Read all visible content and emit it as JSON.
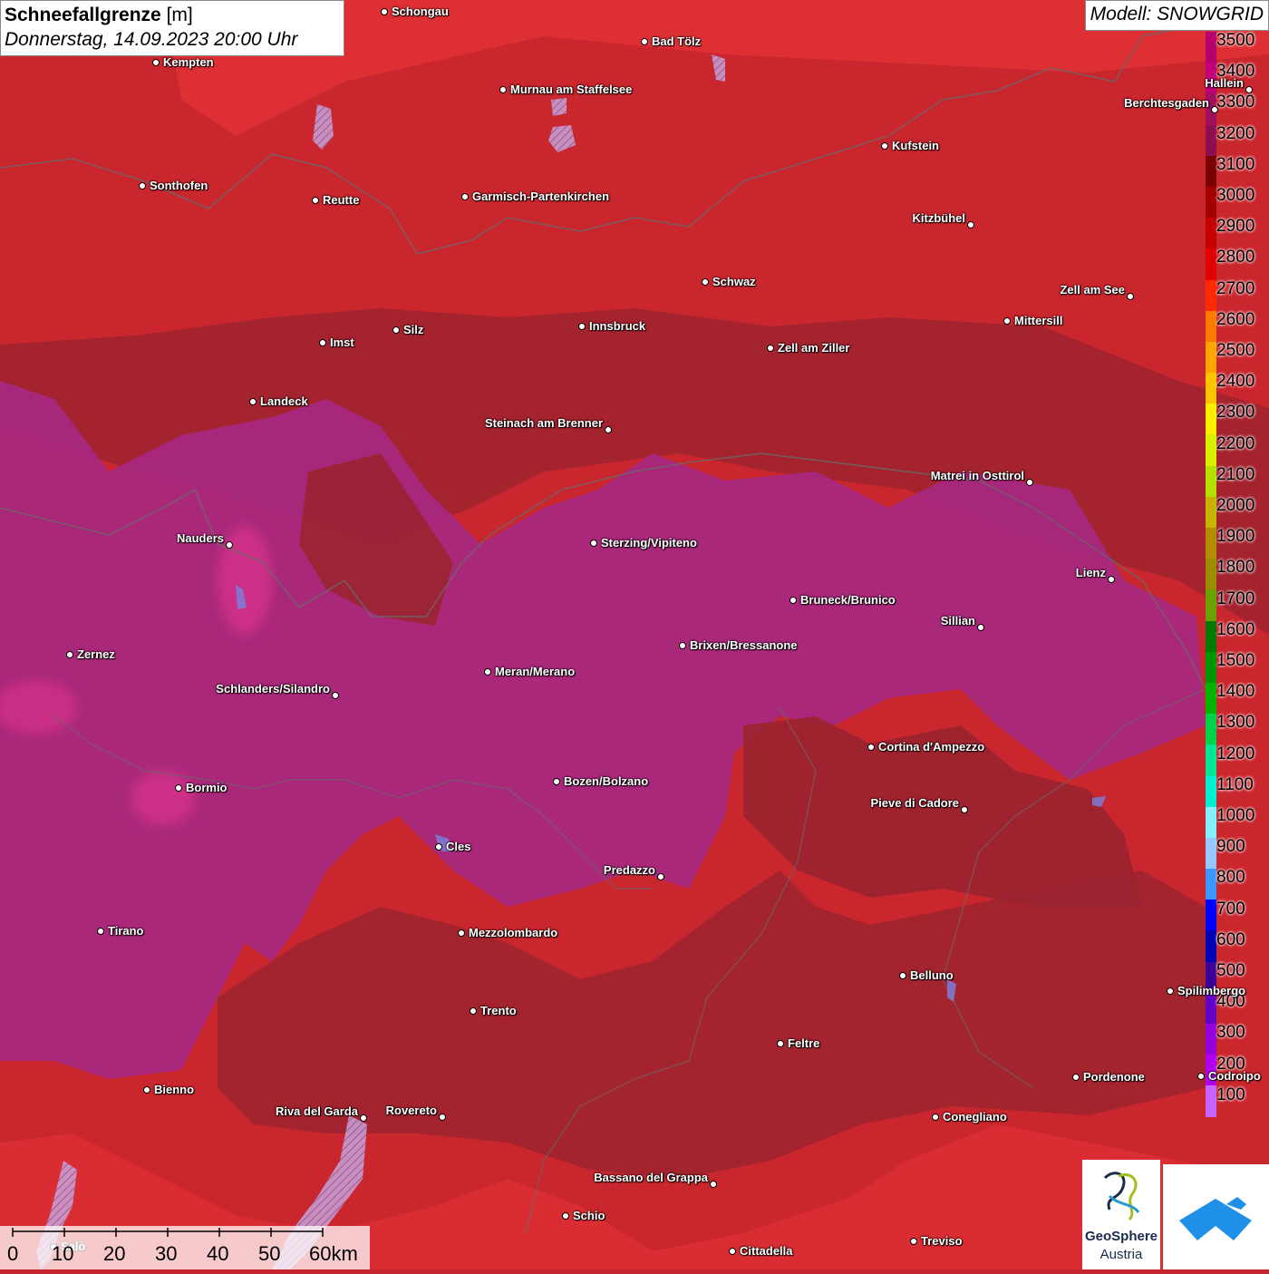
{
  "title": {
    "variable": "Schneefallgrenze",
    "unit": "[m]",
    "datetime": "Donnerstag, 14.09.2023 20:00 Uhr"
  },
  "model_label": "Modell: SNOWGRID",
  "legend": {
    "labels": [
      "3500",
      "3400",
      "3300",
      "3200",
      "3100",
      "3000",
      "2900",
      "2800",
      "2700",
      "2600",
      "2500",
      "2400",
      "2300",
      "2200",
      "2100",
      "2000",
      "1900",
      "1800",
      "1700",
      "1600",
      "1500",
      "1400",
      "1300",
      "1200",
      "1100",
      "1000",
      "900",
      "800",
      "700",
      "600",
      "500",
      "400",
      "300",
      "200",
      "100"
    ],
    "colors": [
      "#b5006e",
      "#c2007a",
      "#a0105e",
      "#8e0f50",
      "#7a0000",
      "#a50000",
      "#c40000",
      "#e00000",
      "#ff2a00",
      "#ff7a00",
      "#ffa500",
      "#ffc400",
      "#ffee00",
      "#d8f000",
      "#b4e000",
      "#c8b400",
      "#b48c00",
      "#9c8c00",
      "#6aa000",
      "#007a00",
      "#009600",
      "#00b400",
      "#00d24a",
      "#00e696",
      "#00f0d2",
      "#82f0ff",
      "#96c8ff",
      "#3c96ff",
      "#0000ff",
      "#0000b4",
      "#3c0096",
      "#6400c8",
      "#9600dc",
      "#b400f0",
      "#c864ff"
    ]
  },
  "scale": {
    "ticks": [
      "0",
      "10",
      "20",
      "30",
      "40",
      "50",
      "60km"
    ]
  },
  "logos": {
    "geosphere_line1": "GeoSphere",
    "geosphere_line2": "Austria"
  },
  "cities": [
    {
      "name": "Schongau"
    },
    {
      "name": "Kempten"
    },
    {
      "name": "Bad Tölz"
    },
    {
      "name": "Murnau am Staffelsee"
    },
    {
      "name": "Hallein"
    },
    {
      "name": "Berchtesgaden"
    },
    {
      "name": "Kufstein"
    },
    {
      "name": "Sonthofen"
    },
    {
      "name": "Reutte"
    },
    {
      "name": "Garmisch-Partenkirchen"
    },
    {
      "name": "Kitzbühel"
    },
    {
      "name": "Schwaz"
    },
    {
      "name": "Zell am See"
    },
    {
      "name": "Mittersill"
    },
    {
      "name": "Innsbruck"
    },
    {
      "name": "Silz"
    },
    {
      "name": "Imst"
    },
    {
      "name": "Zell am Ziller"
    },
    {
      "name": "Landeck"
    },
    {
      "name": "Steinach am Brenner"
    },
    {
      "name": "Matrei in Osttirol"
    },
    {
      "name": "Nauders"
    },
    {
      "name": "Sterzing/Vipiteno"
    },
    {
      "name": "Lienz"
    },
    {
      "name": "Bruneck/Brunico"
    },
    {
      "name": "Sillian"
    },
    {
      "name": "Zernez"
    },
    {
      "name": "Brixen/Bressanone"
    },
    {
      "name": "Meran/Merano"
    },
    {
      "name": "Schlanders/Silandro"
    },
    {
      "name": "Cortina d'Ampezzo"
    },
    {
      "name": "Bormio"
    },
    {
      "name": "Bozen/Bolzano"
    },
    {
      "name": "Pieve di Cadore"
    },
    {
      "name": "Cles"
    },
    {
      "name": "Predazzo"
    },
    {
      "name": "Tirano"
    },
    {
      "name": "Mezzolombardo"
    },
    {
      "name": "Belluno"
    },
    {
      "name": "Spilimbergo"
    },
    {
      "name": "Trento"
    },
    {
      "name": "Feltre"
    },
    {
      "name": "Pordenone"
    },
    {
      "name": "Codroipo"
    },
    {
      "name": "Bienno"
    },
    {
      "name": "Riva del Garda"
    },
    {
      "name": "Rovereto"
    },
    {
      "name": "Conegliano"
    },
    {
      "name": "Bassano del Grappa"
    },
    {
      "name": "Schio"
    },
    {
      "name": "Treviso"
    },
    {
      "name": "Cittadella"
    },
    {
      "name": "Salò"
    }
  ]
}
